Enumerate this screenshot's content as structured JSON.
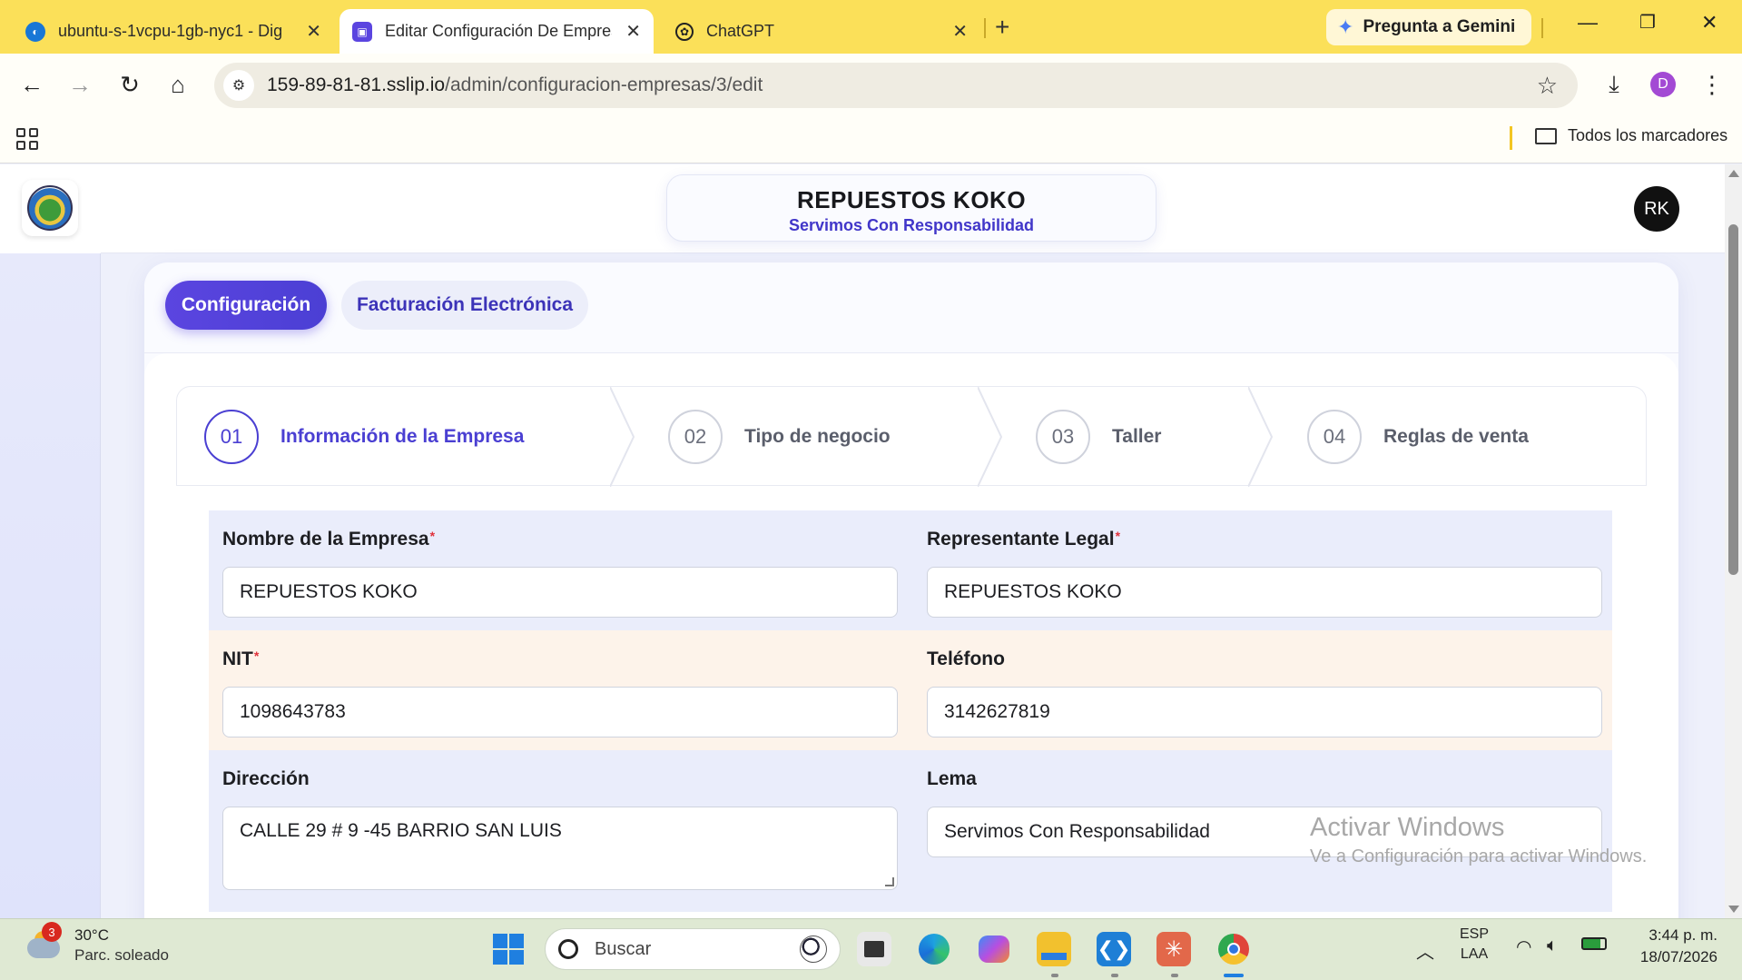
{
  "browser": {
    "tabs": [
      {
        "title": "ubuntu-s-1vcpu-1gb-nyc1 - Dig",
        "active": false
      },
      {
        "title": "Editar Configuración De Empres",
        "active": true
      },
      {
        "title": "ChatGPT",
        "active": false
      }
    ],
    "new_tab_label": "+",
    "gemini_label": "Pregunta a Gemini",
    "url_host": "159-89-81-81.sslip.io",
    "url_path": "/admin/configuracion-empresas/3/edit",
    "profile_initial": "D",
    "all_bookmarks_label": "Todos los marcadores"
  },
  "app": {
    "company_name": "REPUESTOS KOKO",
    "company_slogan": "Servimos Con Responsabilidad",
    "user_initials": "RK",
    "tabs": [
      {
        "label": "Configuración",
        "active": true
      },
      {
        "label": "Facturación Electrónica",
        "active": false
      }
    ],
    "steps": [
      {
        "num": "01",
        "label": "Información de la Empresa",
        "current": true
      },
      {
        "num": "02",
        "label": "Tipo de negocio",
        "current": false
      },
      {
        "num": "03",
        "label": "Taller",
        "current": false
      },
      {
        "num": "04",
        "label": "Reglas de venta",
        "current": false
      }
    ],
    "form": {
      "nombre_label": "Nombre de la Empresa",
      "nombre_value": "REPUESTOS KOKO",
      "representante_label": "Representante Legal",
      "representante_value": "REPUESTOS KOKO",
      "nit_label": "NIT",
      "nit_value": "1098643783",
      "telefono_label": "Teléfono",
      "telefono_value": "3142627819",
      "direccion_label": "Dirección",
      "direccion_value": "CALLE 29 # 9 -45 BARRIO SAN LUIS",
      "lema_label": "Lema",
      "lema_value": "Servimos Con Responsabilidad",
      "required_mark": "*"
    },
    "colors": {
      "accent": "#4b3fd4",
      "required": "#e0313b"
    }
  },
  "watermark": {
    "line1": "Activar Windows",
    "line2": "Ve a Configuración para activar Windows."
  },
  "taskbar": {
    "weather_temp": "30°C",
    "weather_desc": "Parc. soleado",
    "weather_badge": "3",
    "search_placeholder": "Buscar",
    "lang_top": "ESP",
    "lang_bottom": "LAA",
    "time": "3:44 p. m.",
    "date": "18/07/2026"
  }
}
